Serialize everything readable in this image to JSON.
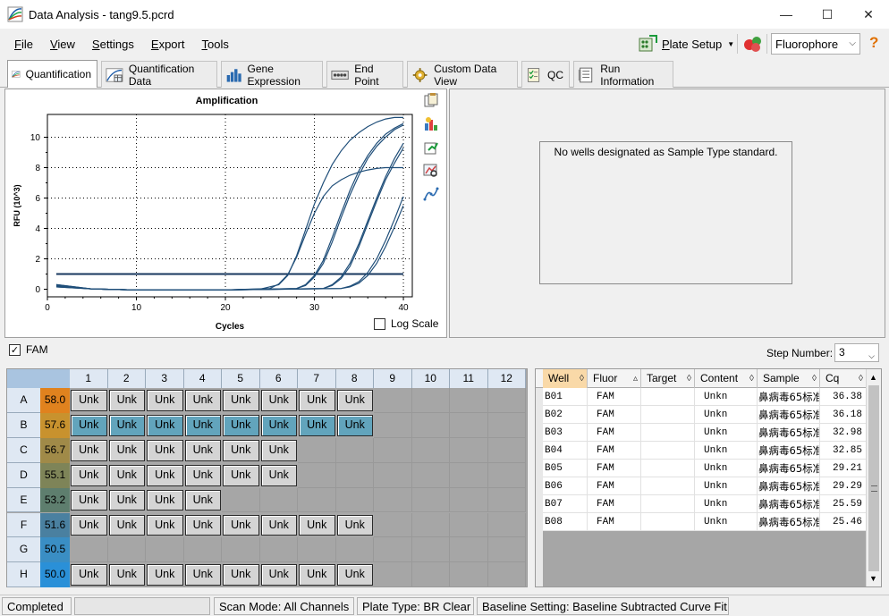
{
  "window": {
    "title": "Data Analysis - tang9.5.pcrd",
    "min": "—",
    "max": "☐",
    "close": "✕"
  },
  "menu": [
    {
      "label": "File",
      "ul": "F",
      "rest": "ile"
    },
    {
      "label": "View",
      "ul": "V",
      "rest": "iew"
    },
    {
      "label": "Settings",
      "ul": "S",
      "rest": "ettings"
    },
    {
      "label": "Export",
      "ul": "E",
      "rest": "xport"
    },
    {
      "label": "Tools",
      "ul": "T",
      "rest": "ools"
    }
  ],
  "toolbar": {
    "plate_setup": "Plate Setup",
    "plate_setup_ul": "P",
    "plate_setup_rest": "late Setup",
    "fluorophore": "Fluorophore",
    "help": "?"
  },
  "tabs": [
    {
      "label": "Quantification",
      "icon": "amplification-icon",
      "active": true
    },
    {
      "label": "Quantification Data",
      "icon": "quant-data-icon"
    },
    {
      "label": "Gene Expression",
      "icon": "bar-chart-icon"
    },
    {
      "label": "End Point",
      "icon": "end-point-icon"
    },
    {
      "label": "Custom Data View",
      "icon": "gear-icon"
    },
    {
      "label": "QC",
      "icon": "qc-checklist-icon"
    },
    {
      "label": "Run Information",
      "icon": "run-info-icon"
    }
  ],
  "chart_data": {
    "type": "line",
    "title": "Amplification",
    "xlabel": "Cycles",
    "ylabel": "RFU (10^3)",
    "xlim": [
      0,
      41
    ],
    "ylim": [
      -0.5,
      11.5
    ],
    "xticks": [
      0,
      10,
      20,
      30,
      40
    ],
    "yticks": [
      0,
      2,
      4,
      6,
      8,
      10
    ],
    "grid": true,
    "threshold": 1.0,
    "series": [
      {
        "values": [
          [
            1,
            0.15
          ],
          [
            5,
            0.02
          ],
          [
            10,
            -0.05
          ],
          [
            20,
            -0.05
          ],
          [
            24,
            0.02
          ],
          [
            26,
            0.3
          ],
          [
            27,
            0.9
          ],
          [
            28,
            2.2
          ],
          [
            29,
            3.9
          ],
          [
            30,
            5.6
          ],
          [
            31,
            7.0
          ],
          [
            32,
            8.2
          ],
          [
            33,
            9.1
          ],
          [
            34,
            9.8
          ],
          [
            35,
            10.3
          ],
          [
            36,
            10.7
          ],
          [
            37,
            11.0
          ],
          [
            38,
            11.2
          ],
          [
            39,
            11.3
          ],
          [
            40,
            11.3
          ]
        ]
      },
      {
        "values": [
          [
            1,
            0.15
          ],
          [
            5,
            0.02
          ],
          [
            10,
            -0.05
          ],
          [
            20,
            -0.05
          ],
          [
            25,
            0.05
          ],
          [
            26,
            0.35
          ],
          [
            27,
            0.95
          ],
          [
            28,
            2.1
          ],
          [
            29,
            3.6
          ],
          [
            30,
            5.0
          ],
          [
            31,
            6.1
          ],
          [
            32,
            6.8
          ],
          [
            33,
            7.2
          ],
          [
            34,
            7.5
          ],
          [
            35,
            7.7
          ],
          [
            36,
            7.85
          ],
          [
            37,
            7.95
          ],
          [
            38,
            8.0
          ],
          [
            39,
            8.0
          ],
          [
            40,
            8.0
          ]
        ]
      },
      {
        "values": [
          [
            1,
            0.2
          ],
          [
            5,
            0.02
          ],
          [
            10,
            -0.05
          ],
          [
            20,
            -0.05
          ],
          [
            28,
            0.05
          ],
          [
            29,
            0.3
          ],
          [
            30,
            0.9
          ],
          [
            31,
            1.9
          ],
          [
            32,
            3.4
          ],
          [
            33,
            5.0
          ],
          [
            34,
            6.5
          ],
          [
            35,
            7.8
          ],
          [
            36,
            8.8
          ],
          [
            37,
            9.6
          ],
          [
            38,
            10.2
          ],
          [
            39,
            10.6
          ],
          [
            40,
            10.9
          ]
        ]
      },
      {
        "values": [
          [
            1,
            0.2
          ],
          [
            5,
            0.02
          ],
          [
            10,
            -0.05
          ],
          [
            20,
            -0.05
          ],
          [
            28,
            0.05
          ],
          [
            29,
            0.25
          ],
          [
            30,
            0.8
          ],
          [
            31,
            1.7
          ],
          [
            32,
            3.1
          ],
          [
            33,
            4.7
          ],
          [
            34,
            6.2
          ],
          [
            35,
            7.5
          ],
          [
            36,
            8.6
          ],
          [
            37,
            9.4
          ],
          [
            38,
            10.0
          ],
          [
            39,
            10.5
          ],
          [
            40,
            10.8
          ]
        ]
      },
      {
        "values": [
          [
            1,
            0.25
          ],
          [
            5,
            0.02
          ],
          [
            10,
            -0.05
          ],
          [
            20,
            -0.05
          ],
          [
            31,
            0.05
          ],
          [
            32,
            0.3
          ],
          [
            33,
            0.8
          ],
          [
            34,
            1.7
          ],
          [
            35,
            3.0
          ],
          [
            36,
            4.5
          ],
          [
            37,
            6.0
          ],
          [
            38,
            7.4
          ],
          [
            39,
            8.6
          ],
          [
            40,
            9.6
          ]
        ]
      },
      {
        "values": [
          [
            1,
            0.25
          ],
          [
            5,
            0.02
          ],
          [
            10,
            -0.05
          ],
          [
            20,
            -0.05
          ],
          [
            31,
            0.05
          ],
          [
            32,
            0.25
          ],
          [
            33,
            0.7
          ],
          [
            34,
            1.5
          ],
          [
            35,
            2.8
          ],
          [
            36,
            4.3
          ],
          [
            37,
            5.8
          ],
          [
            38,
            7.2
          ],
          [
            39,
            8.3
          ],
          [
            40,
            9.3
          ]
        ]
      },
      {
        "values": [
          [
            1,
            0.3
          ],
          [
            5,
            0.02
          ],
          [
            10,
            -0.05
          ],
          [
            20,
            -0.05
          ],
          [
            33,
            0.05
          ],
          [
            34,
            0.2
          ],
          [
            35,
            0.5
          ],
          [
            36,
            1.1
          ],
          [
            37,
            2.0
          ],
          [
            38,
            3.2
          ],
          [
            39,
            4.6
          ],
          [
            40,
            6.1
          ]
        ]
      },
      {
        "values": [
          [
            1,
            0.3
          ],
          [
            5,
            0.02
          ],
          [
            10,
            -0.05
          ],
          [
            20,
            -0.05
          ],
          [
            33,
            0.05
          ],
          [
            34,
            0.15
          ],
          [
            35,
            0.4
          ],
          [
            36,
            0.9
          ],
          [
            37,
            1.7
          ],
          [
            38,
            2.8
          ],
          [
            39,
            4.1
          ],
          [
            40,
            5.5
          ]
        ]
      }
    ]
  },
  "chart": {
    "log_scale_label": "Log Scale",
    "log_scale_checked": false,
    "color": "#1f4e79",
    "threshold_color": "#17375e"
  },
  "standards": {
    "message": "No wells designated as Sample Type standard."
  },
  "fluor_row": {
    "label": "FAM",
    "checked": true,
    "step_label": "Step Number:",
    "step_value": "3"
  },
  "plate": {
    "columns": [
      "1",
      "2",
      "3",
      "4",
      "5",
      "6",
      "7",
      "8",
      "9",
      "10",
      "11",
      "12"
    ],
    "rows": [
      {
        "label": "A",
        "temp": "58.0",
        "color": "#e0821e",
        "wells": 8,
        "selected": false
      },
      {
        "label": "B",
        "temp": "57.6",
        "color": "#c8922e",
        "wells": 8,
        "selected": true
      },
      {
        "label": "C",
        "temp": "56.7",
        "color": "#a08a48",
        "wells": 6,
        "selected": false
      },
      {
        "label": "D",
        "temp": "55.1",
        "color": "#7e8458",
        "wells": 6,
        "selected": false
      },
      {
        "label": "E",
        "temp": "53.2",
        "color": "#5e7e6e",
        "wells": 4,
        "selected": false
      },
      {
        "label": "F",
        "temp": "51.6",
        "color": "#4a80a0",
        "wells": 8,
        "selected": false
      },
      {
        "label": "G",
        "temp": "50.5",
        "color": "#3a8ec4",
        "wells": 0,
        "selected": false
      },
      {
        "label": "H",
        "temp": "50.0",
        "color": "#2a90d8",
        "wells": 8,
        "selected": false
      }
    ],
    "well_label": "Unk"
  },
  "table": {
    "headers": [
      "Well",
      "Fluor",
      "Target",
      "Content",
      "Sample",
      "Cq"
    ],
    "rows": [
      {
        "well": "B01",
        "fluor": "FAM",
        "target": "",
        "content": "Unkn",
        "sample": "鼻病毒65标准",
        "cq": "36.38"
      },
      {
        "well": "B02",
        "fluor": "FAM",
        "target": "",
        "content": "Unkn",
        "sample": "鼻病毒65标准",
        "cq": "36.18"
      },
      {
        "well": "B03",
        "fluor": "FAM",
        "target": "",
        "content": "Unkn",
        "sample": "鼻病毒65标准",
        "cq": "32.98"
      },
      {
        "well": "B04",
        "fluor": "FAM",
        "target": "",
        "content": "Unkn",
        "sample": "鼻病毒65标准",
        "cq": "32.85"
      },
      {
        "well": "B05",
        "fluor": "FAM",
        "target": "",
        "content": "Unkn",
        "sample": "鼻病毒65标准",
        "cq": "29.21"
      },
      {
        "well": "B06",
        "fluor": "FAM",
        "target": "",
        "content": "Unkn",
        "sample": "鼻病毒65标准",
        "cq": "29.29"
      },
      {
        "well": "B07",
        "fluor": "FAM",
        "target": "",
        "content": "Unkn",
        "sample": "鼻病毒65标准",
        "cq": "25.59"
      },
      {
        "well": "B08",
        "fluor": "FAM",
        "target": "",
        "content": "Unkn",
        "sample": "鼻病毒65标准",
        "cq": "25.46"
      }
    ]
  },
  "status": {
    "state": "Completed",
    "scan_mode": "Scan Mode: All Channels",
    "plate_type": "Plate Type: BR Clear",
    "baseline": "Baseline Setting: Baseline Subtracted Curve Fit"
  }
}
